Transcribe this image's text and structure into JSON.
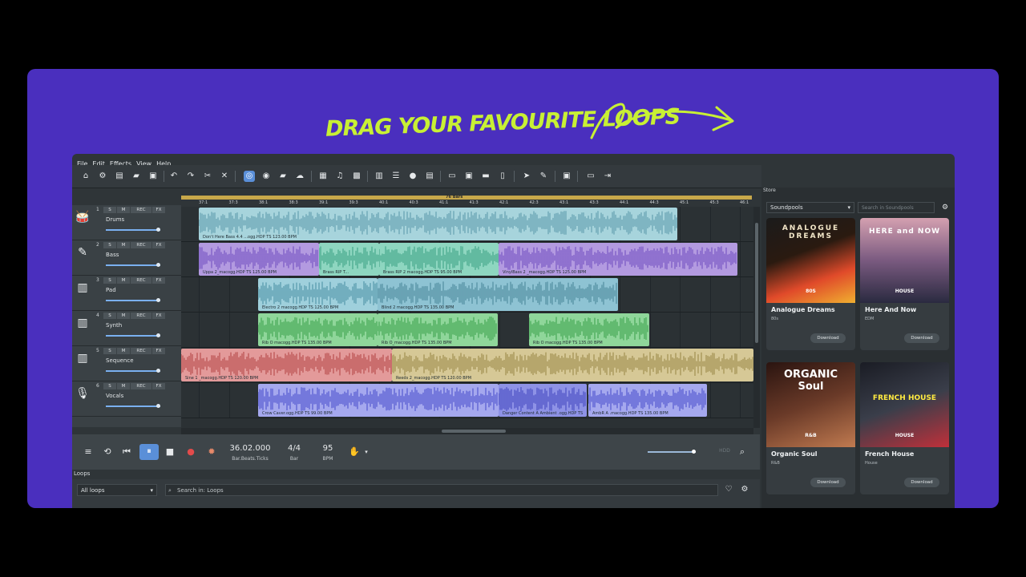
{
  "headline": "DRAG YOUR FAVOURITE LOOPS",
  "menu": [
    "File",
    "Edit",
    "Effects",
    "View",
    "Help"
  ],
  "toolbar_icons": [
    "home-icon",
    "settings-icon",
    "new-file-icon",
    "open-folder-icon",
    "open-icon",
    "save-icon",
    "undo-icon",
    "redo-icon",
    "cut-icon",
    "delete-icon",
    "loop-mode-icon",
    "globe-icon",
    "folder-icon",
    "upload-icon",
    "image-icon",
    "music-note-icon",
    "grid-icon",
    "keyboard-icon",
    "mixer-icon",
    "record-icon",
    "library-icon",
    "monitor-icon",
    "video-icon",
    "media-icon",
    "split-icon",
    "pointer-icon",
    "magic-cursor-icon",
    "snapshot-icon",
    "fit-icon",
    "export-icon"
  ],
  "arrangement": {
    "loop_bar_label": "76 Bars",
    "ruler_ticks": [
      "37:1",
      "37:3",
      "38:1",
      "38:3",
      "39:1",
      "39:3",
      "40:1",
      "40:3",
      "41:1",
      "41:3",
      "42:1",
      "42:3",
      "43:1",
      "43:3",
      "44:1",
      "44:3",
      "45:1",
      "45:3",
      "46:1"
    ]
  },
  "tracks": [
    {
      "num": "1",
      "name": "Drums",
      "icon": "drums-icon",
      "buttons": [
        "S",
        "M",
        "REC",
        "FX"
      ]
    },
    {
      "num": "2",
      "name": "Bass",
      "icon": "bass-guitar-icon",
      "buttons": [
        "S",
        "M",
        "REC",
        "FX"
      ]
    },
    {
      "num": "3",
      "name": "Pad",
      "icon": "keyboard-icon",
      "buttons": [
        "S",
        "M",
        "REC",
        "FX"
      ]
    },
    {
      "num": "4",
      "name": "Synth",
      "icon": "keyboard-icon",
      "buttons": [
        "S",
        "M",
        "REC",
        "FX"
      ]
    },
    {
      "num": "5",
      "name": "Sequence",
      "icon": "keyboard-icon",
      "buttons": [
        "S",
        "M",
        "REC",
        "FX"
      ]
    },
    {
      "num": "6",
      "name": "Vocals",
      "icon": "microphone-icon",
      "buttons": [
        "S",
        "M",
        "REC",
        "FX"
      ]
    }
  ],
  "clips": [
    {
      "track": 0,
      "label": "Don't Here Bass 4.4 ...ogg.HDP TS 123.00 BPM",
      "color": "#a7d4dc"
    },
    {
      "track": 1,
      "label": "Uppa 2_macogg.HDP TS 125.00 BPM",
      "color": "#b39ae0"
    },
    {
      "track": 1,
      "label": "Brass RIP T...",
      "color": "#8ed6c0"
    },
    {
      "track": 1,
      "label": "Brass RIP 2 macogg.HDP TS 95.00 BPM",
      "color": "#8ed6c0"
    },
    {
      "track": 1,
      "label": "VinylBass 2 _macogg.HDP TS 125.00 BPM",
      "color": "#b39ae0"
    },
    {
      "track": 2,
      "label": "Electro 2 macogg.HDP TS 125.00 BPM",
      "color": "#9fd0dc"
    },
    {
      "track": 2,
      "label": "Blind 2 macogg.HDP TS 135.00 BPM",
      "color": "#8ec3d3"
    },
    {
      "track": 3,
      "label": "Rib O macogg.HDP TS 135.00 BPM",
      "color": "#8fd69a"
    },
    {
      "track": 3,
      "label": "Rib O_macogg.HDP TS 135.00 BPM",
      "color": "#8fd69a"
    },
    {
      "track": 3,
      "label": "Rib O macogg.HDP TS 135.00 BPM",
      "color": "#8fd69a"
    },
    {
      "track": 4,
      "label": "Sine 1 _macogg.HDP TS 120.00 BPM",
      "color": "#e39a9a"
    },
    {
      "track": 4,
      "label": "Reeds 2_macogg.HDP TS 120.00 BPM",
      "color": "#d6c896"
    },
    {
      "track": 5,
      "label": "Crow Caver.ogg.HDP TS 99.00 BPM",
      "color": "#a5a8ee"
    },
    {
      "track": 5,
      "label": "Danger Content A Ambient .ogg.HDP TS",
      "color": "#8e92e6"
    },
    {
      "track": 5,
      "label": "AmbR A .macogg.HDP TS 135.00 BPM",
      "color": "#a5a8ee"
    }
  ],
  "transport": {
    "position_value": "36.02.000",
    "position_label": "Bar.Beats.Ticks",
    "signature_value": "4/4",
    "signature_label": "Bar",
    "tempo_value": "95",
    "tempo_label": "BPM",
    "hdd_label": "HDD"
  },
  "loops_panel": {
    "title": "Loops",
    "filter_value": "All loops",
    "search_placeholder": "Search in: Loops"
  },
  "store": {
    "title": "Store",
    "filter_value": "Soundpools",
    "search_placeholder": "Search in Soundpools",
    "download_label": "Download",
    "cards": [
      {
        "title": "Analogue Dreams",
        "genre": "80s",
        "art_text": "ANALOGUE DREAMS",
        "art_badge": "80S"
      },
      {
        "title": "Here And Now",
        "genre": "EDM",
        "art_text": "HERE and NOW",
        "art_badge": "HOUSE"
      },
      {
        "title": "Organic Soul",
        "genre": "R&B",
        "art_text": "ORGANIC Soul",
        "art_badge": "R&B"
      },
      {
        "title": "French House",
        "genre": "House",
        "art_text": "FRENCH HOUSE",
        "art_badge": "HOUSE"
      }
    ]
  },
  "colors": {
    "background_purple": "#4a2fbe",
    "headline_green": "#c8f034",
    "app_dark": "#2f3538",
    "accent_blue": "#5a8fd8",
    "record_red": "#e24b4b"
  }
}
